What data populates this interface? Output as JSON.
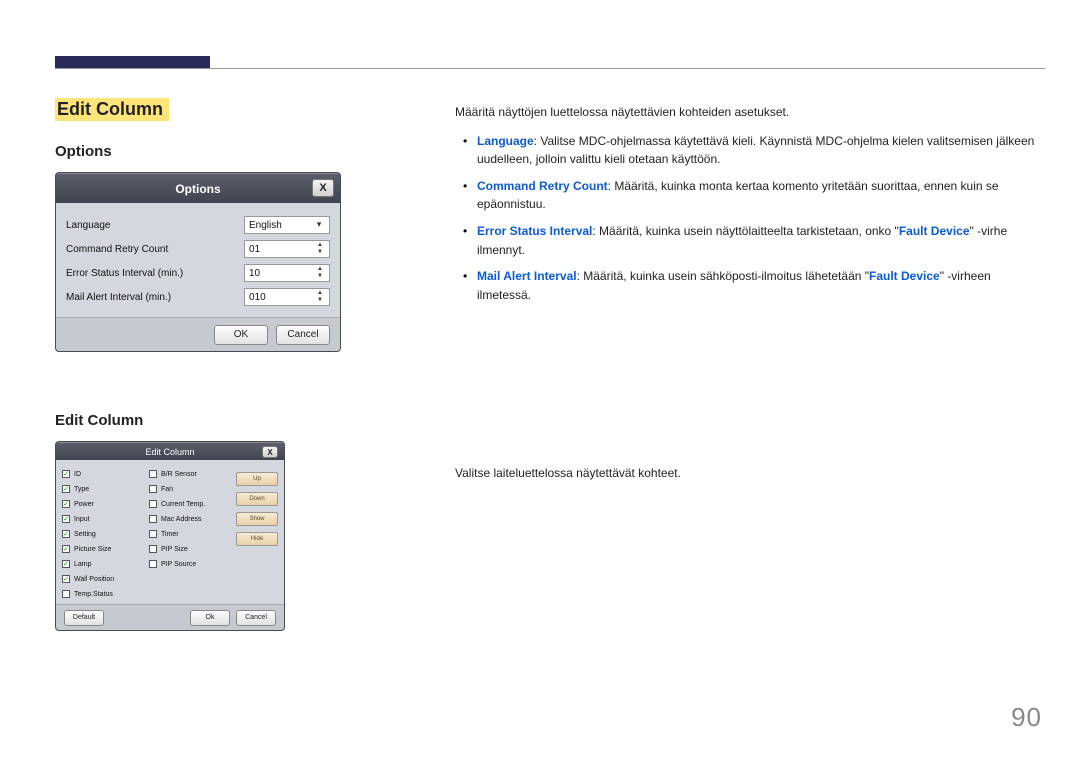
{
  "section_title": "Edit Column",
  "options_heading": "Options",
  "editcol_heading": "Edit Column",
  "page_number": "90",
  "options_dialog": {
    "title": "Options",
    "close": "X",
    "rows": [
      {
        "label": "Language",
        "value": "English",
        "type": "dropdown"
      },
      {
        "label": "Command Retry Count",
        "value": "01",
        "type": "spinner"
      },
      {
        "label": "Error Status Interval (min.)",
        "value": "10",
        "type": "spinner"
      },
      {
        "label": "Mail Alert Interval (min.)",
        "value": "010",
        "type": "spinner"
      }
    ],
    "ok": "OK",
    "cancel": "Cancel"
  },
  "editcol_dialog": {
    "title": "Edit Column",
    "close": "X",
    "col1": [
      {
        "label": "ID",
        "checked": true
      },
      {
        "label": "Type",
        "checked": true
      },
      {
        "label": "Power",
        "checked": true
      },
      {
        "label": "Input",
        "checked": true
      },
      {
        "label": "Setting",
        "checked": true
      },
      {
        "label": "Picture Size",
        "checked": true
      },
      {
        "label": "Lamp",
        "checked": true
      },
      {
        "label": "Wall Position",
        "checked": true
      },
      {
        "label": "Temp.Status",
        "checked": false
      }
    ],
    "col2": [
      {
        "label": "B/R Sensor",
        "checked": false
      },
      {
        "label": "Fan",
        "checked": false
      },
      {
        "label": "Current Temp.",
        "checked": false
      },
      {
        "label": "Mac Address",
        "checked": false
      },
      {
        "label": "Timer",
        "checked": false
      },
      {
        "label": "PIP Size",
        "checked": false
      },
      {
        "label": "PIP Source",
        "checked": false
      }
    ],
    "side_buttons": [
      "Up",
      "Down",
      "Show",
      "Hide"
    ],
    "default": "Default",
    "ok": "Ok",
    "cancel": "Cancel"
  },
  "text": {
    "intro": "Määritä näyttöjen luettelossa näytettävien kohteiden asetukset.",
    "b1_term": "Language",
    "b1": ": Valitse MDC-ohjelmassa käytettävä kieli. Käynnistä MDC-ohjelma kielen valitsemisen jälkeen uudelleen, jolloin valittu kieli otetaan käyttöön.",
    "b2_term": "Command Retry Count",
    "b2": ": Määritä, kuinka monta kertaa komento yritetään suorittaa, ennen kuin se epäonnistuu.",
    "b3_term": "Error Status Interval",
    "b3_a": ": Määritä, kuinka usein näyttölaitteelta tarkistetaan, onko \"",
    "b3_f": "Fault Device",
    "b3_b": "\" -virhe ilmennyt.",
    "b4_term": "Mail Alert Interval",
    "b4_a": ": Määritä, kuinka usein sähköposti-ilmoitus lähetetään \"",
    "b4_f": "Fault Device",
    "b4_b": "\" -virheen ilmetessä.",
    "editcol_intro": "Valitse laiteluettelossa näytettävät kohteet."
  }
}
